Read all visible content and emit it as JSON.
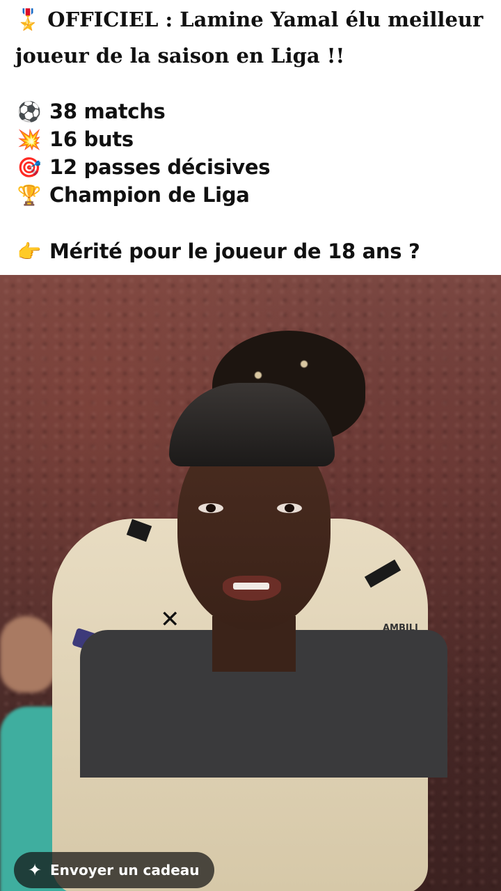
{
  "caption": {
    "headline_emoji": "🎖️",
    "headline": "OFFICIEL : Lamine Yamal élu meilleur joueur de la saison en Liga !!",
    "stats": [
      {
        "emoji": "⚽",
        "text": "38 matchs"
      },
      {
        "emoji": "💥",
        "text": "16 buts"
      },
      {
        "emoji": "🎯",
        "text": "12 passes décisives"
      },
      {
        "emoji": "🏆",
        "text": "Champion de Liga"
      }
    ],
    "question": {
      "emoji": "👉",
      "text": "Mérité pour le joueur de 18 ans ?"
    }
  },
  "media": {
    "jersey_sponsor": "AMBILI",
    "icons": {
      "gift": "gift-icon"
    }
  },
  "gift_button": {
    "label": "Envoyer un cadeau"
  },
  "colors": {
    "caption_bg": "#ffffff",
    "button_bg": "#141414",
    "shirt": "#e8dcc2",
    "tshirt": "#3a3a3c"
  }
}
